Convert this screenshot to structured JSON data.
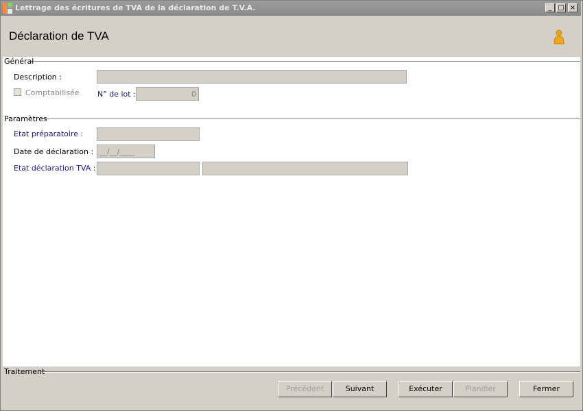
{
  "window": {
    "title": "Lettrage des écritures de TVA de la déclaration de T.V.A.",
    "controls": {
      "minimize": "_",
      "maximize": "□",
      "close": "×"
    }
  },
  "header": {
    "title": "Déclaration de TVA",
    "icon": "user-icon"
  },
  "general": {
    "section_label": "Général",
    "description_label": "Description :",
    "description_value": "",
    "comptabilisee_label": "Comptabilisée",
    "comptabilisee_checked": false,
    "lot_label": "N° de lot :",
    "lot_value": "0"
  },
  "parametres": {
    "section_label": "Paramètres",
    "etat_preparatoire_label": "Etat préparatoire :",
    "etat_preparatoire_value": "",
    "date_label": "Date de déclaration :",
    "date_value": "__/__/____",
    "etat_tva_label": "Etat déclaration TVA :",
    "etat_tva_code": "",
    "etat_tva_description": ""
  },
  "footer": {
    "section_label": "Traitement",
    "buttons": {
      "precedent": "Précédent",
      "suivant": "Suivant",
      "executer": "Exécuter",
      "planifier": "Planifier",
      "fermer": "Fermer"
    }
  },
  "colors": {
    "background": "#d4d0c8",
    "titlebar": "#8a8a8a",
    "link_label": "#1a1a7a"
  }
}
